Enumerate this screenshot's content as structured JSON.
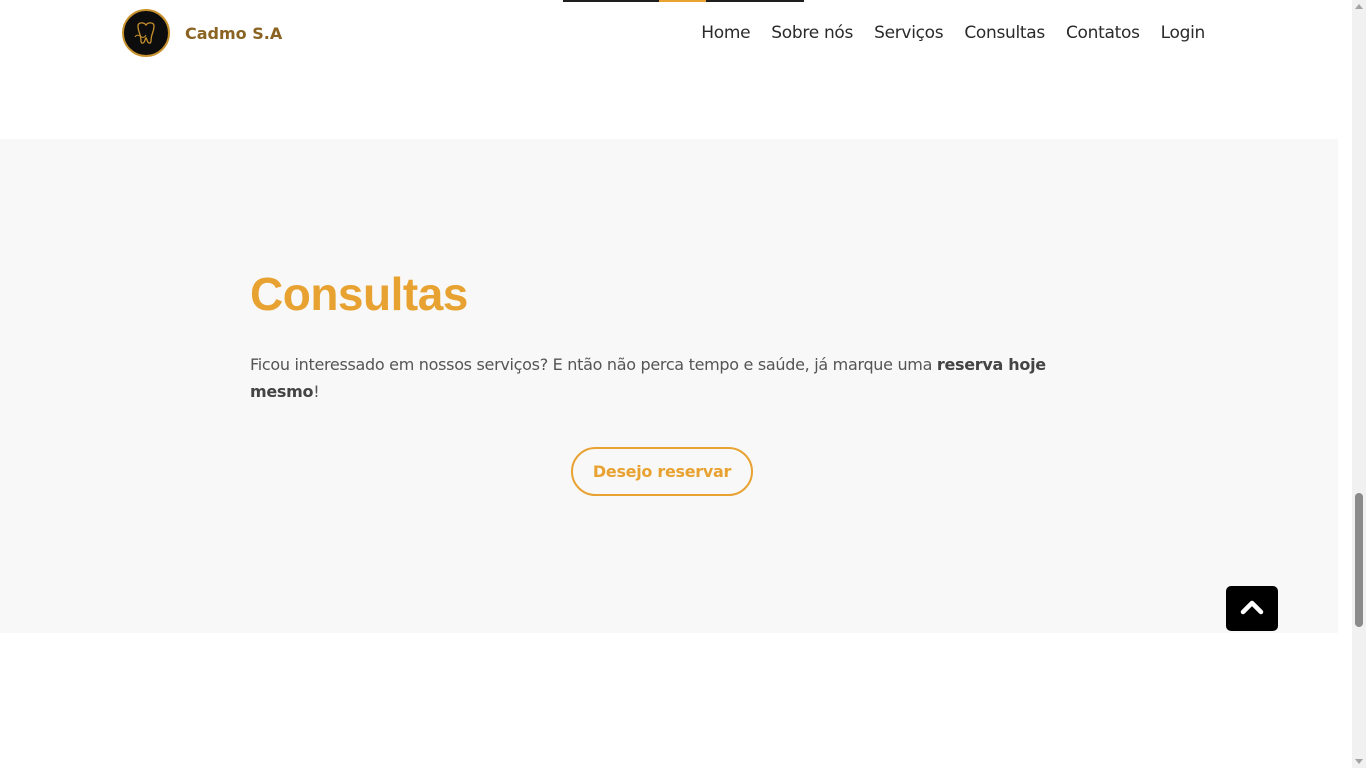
{
  "header": {
    "brand_name": "Cadmo S.A",
    "nav": [
      {
        "label": "Home"
      },
      {
        "label": "Sobre nós"
      },
      {
        "label": "Serviços"
      },
      {
        "label": "Consultas"
      },
      {
        "label": "Contatos"
      },
      {
        "label": "Login"
      }
    ]
  },
  "section": {
    "title": "Consultas",
    "text_before": " Ficou interessado em nossos serviços? E ntão não perca tempo e saúde, já marque uma ",
    "text_bold": "reserva hoje mesmo",
    "text_after": "!",
    "cta_label": "Desejo reservar"
  },
  "icons": {
    "logo": "tooth-logo-icon",
    "back_to_top": "chevron-up-icon"
  },
  "colors": {
    "accent": "#e8a231",
    "brand_text": "#8a6322",
    "section_bg": "#f8f8f8"
  }
}
